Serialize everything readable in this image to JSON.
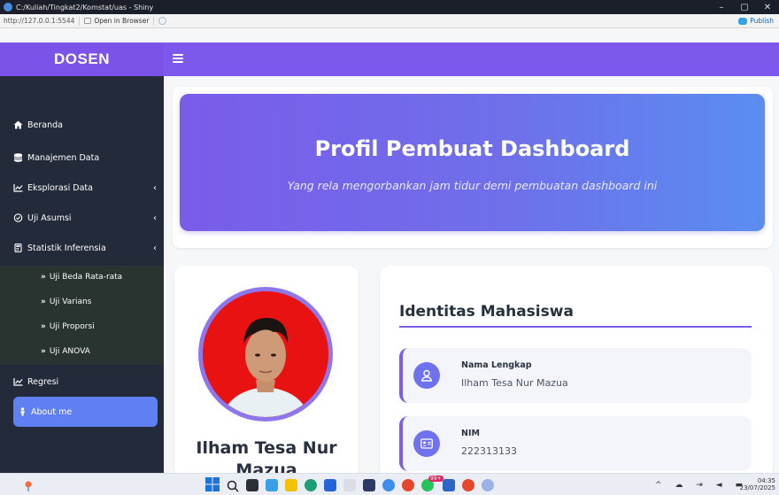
{
  "window": {
    "title": "C:/Kuliah/Tingkat2/Komstat/uas - Shiny",
    "controls": [
      "–",
      "▢",
      "✕"
    ]
  },
  "viewer": {
    "url": "http://127.0.0.1:5544",
    "open_in_browser": "Open in Browser",
    "publish": "Publish"
  },
  "app": {
    "brand": "DOSEN"
  },
  "sidebar": {
    "items": [
      {
        "label": "Beranda",
        "icon": "home-icon"
      },
      {
        "label": "Manajemen Data",
        "icon": "database-icon"
      },
      {
        "label": "Eksplorasi Data",
        "icon": "chart-line-icon",
        "chevron": "‹"
      },
      {
        "label": "Uji Asumsi",
        "icon": "check-circle-icon",
        "chevron": "‹"
      },
      {
        "label": "Statistik Inferensia",
        "icon": "calculator-icon",
        "chevron": "‹"
      },
      {
        "label": "Regresi",
        "icon": "chart-line-icon"
      }
    ],
    "submenu": [
      {
        "label": "Uji Beda Rata-rata"
      },
      {
        "label": "Uji Varians"
      },
      {
        "label": "Uji Proporsi"
      },
      {
        "label": "Uji ANOVA"
      }
    ],
    "about": {
      "label": "About me",
      "icon": "user-icon"
    }
  },
  "hero": {
    "title": "Profil Pembuat Dashboard",
    "subtitle": "Yang rela mengorbankan jam tidur demi pembuatan dashboard ini"
  },
  "profile": {
    "name": "Ilham Tesa Nur Mazua"
  },
  "identity": {
    "title": "Identitas Mahasiswa",
    "fields": [
      {
        "label": "Nama Lengkap",
        "value": "Ilham Tesa Nur Mazua",
        "icon": "user-icon"
      },
      {
        "label": "NIM",
        "value": "222313133",
        "icon": "id-card-icon"
      }
    ]
  },
  "taskbar": {
    "time": "04:35",
    "date": "23/07/2025",
    "badge": "99+"
  },
  "colors": {
    "sidebar_bg": "#232a3a",
    "header_bg": "#7b53e8",
    "accent": "#7b5ee6",
    "about_bg": "#5f7ff2"
  }
}
